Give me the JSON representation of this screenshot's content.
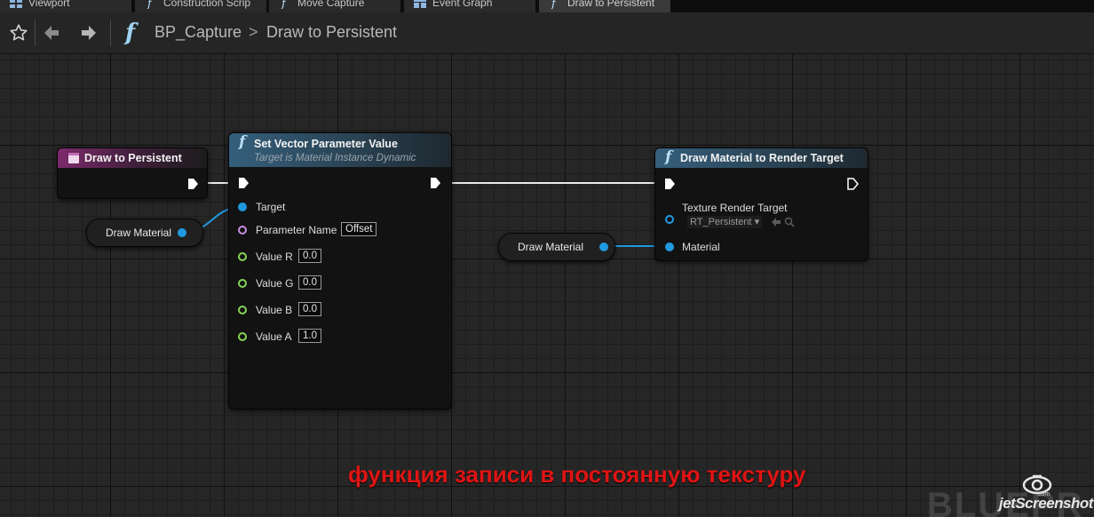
{
  "tabs": [
    {
      "label": "Viewport",
      "icon": "viewport-icon"
    },
    {
      "label": "Construction Scrip",
      "icon": "function-icon"
    },
    {
      "label": "Move Capture",
      "icon": "function-icon"
    },
    {
      "label": "Event Graph",
      "icon": "event-graph-icon"
    },
    {
      "label": "Draw to Persistent",
      "icon": "function-icon"
    }
  ],
  "breadcrumb": {
    "blueprint": "BP_Capture",
    "separator": ">",
    "function": "Draw to Persistent"
  },
  "nodes": {
    "entry": {
      "title": "Draw to Persistent"
    },
    "set_vector": {
      "glyph": "f",
      "title": "Set Vector Parameter Value",
      "subtitle": "Target is Material Instance Dynamic",
      "pins": {
        "target": "Target",
        "parameter_name": "Parameter Name",
        "parameter_value": "Offset",
        "value_r": "Value R",
        "value_r_val": "0.0",
        "value_g": "Value G",
        "value_g_val": "0.0",
        "value_b": "Value B",
        "value_b_val": "0.0",
        "value_a": "Value A",
        "value_a_val": "1.0"
      }
    },
    "draw_material": {
      "glyph": "f",
      "title": "Draw Material to Render Target",
      "pins": {
        "texture_render_target": "Texture Render Target",
        "texture_value": "RT_Persistent",
        "material": "Material"
      }
    },
    "var_left": {
      "label": "Draw Material"
    },
    "var_right": {
      "label": "Draw Material"
    }
  },
  "caption": "функция записи в постоянную текстуру",
  "watermark": {
    "text": "jetScreenshot",
    "suffix": ".com",
    "background_text": "BLUEPR"
  },
  "colors": {
    "exec_wire": "#e8e8e8",
    "object_pin": "#1f9ae0",
    "name_pin": "#c98ee0",
    "float_pin": "#86d455",
    "event_header": "#7c2a6c",
    "function_header": "#355f7c",
    "caption": "#e01414"
  }
}
